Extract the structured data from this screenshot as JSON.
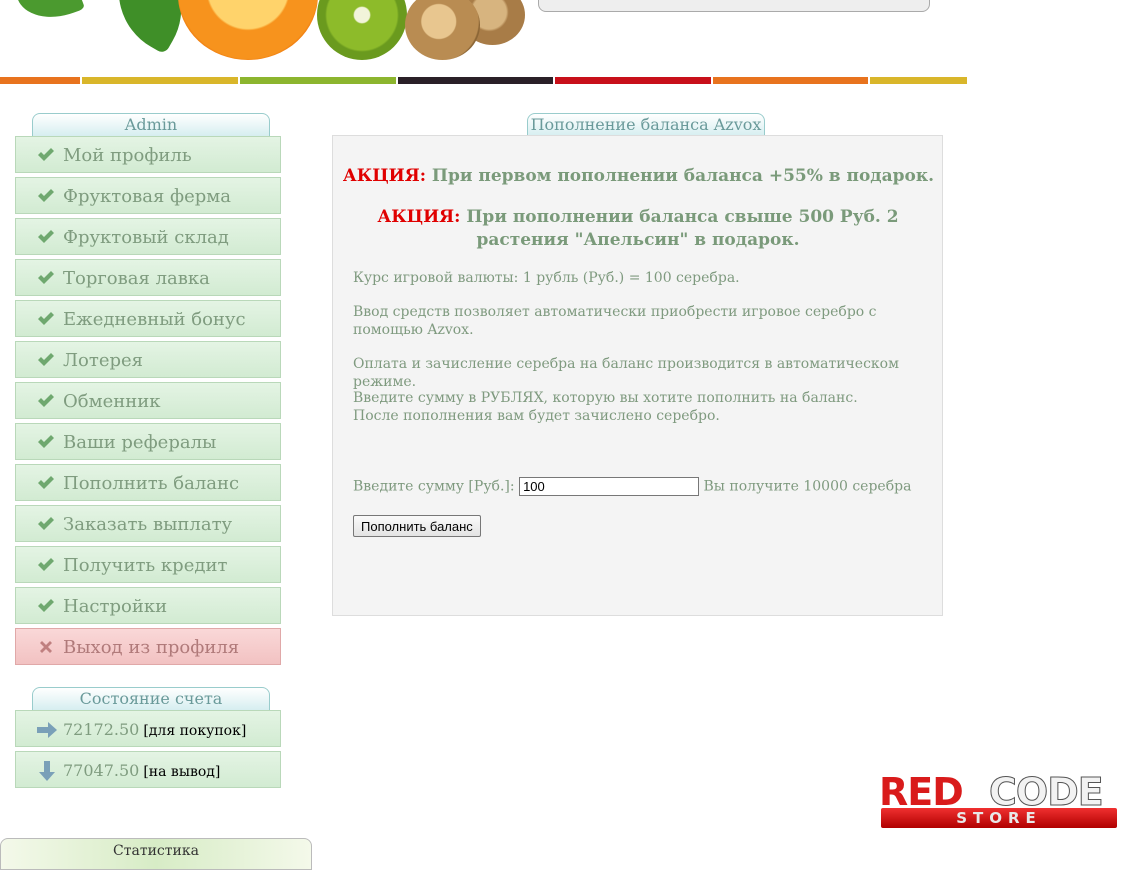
{
  "sidebar": {
    "section_title": "Admin",
    "items": [
      {
        "label": "Мой профиль"
      },
      {
        "label": "Фруктовая ферма"
      },
      {
        "label": "Фруктовый склад"
      },
      {
        "label": "Торговая лавка"
      },
      {
        "label": "Ежедневный бонус"
      },
      {
        "label": "Лотерея"
      },
      {
        "label": "Обменник"
      },
      {
        "label": "Ваши рефералы"
      },
      {
        "label": "Пополнить баланс"
      },
      {
        "label": "Заказать выплату"
      },
      {
        "label": "Получить кредит"
      },
      {
        "label": "Настройки"
      }
    ],
    "exit_label": "Выход из профиля"
  },
  "account": {
    "title": "Состояние счета",
    "purchase_balance": "72172.50",
    "purchase_note": "[для покупок]",
    "withdraw_balance": "77047.50",
    "withdraw_note": "[на вывод]"
  },
  "stats": {
    "title": "Статистика"
  },
  "main": {
    "tab_title": "Пополнение баланса Azvox",
    "promo1_label": "АКЦИЯ:",
    "promo1_text": "При первом пополнении баланса +55% в подарок.",
    "promo2_label": "АКЦИЯ:",
    "promo2_text": "При пополнении баланса свыше 500 Руб. 2 растения \"Апельсин\" в подарок.",
    "rate_text": "Курс игровой валюты: 1 рубль (Руб.) = 100 серебра.",
    "info1": "Ввод средств позволяет автоматически приобрести игровое серебро с помощью Azvox.",
    "info2": "Оплата и зачисление серебра на баланс производится в автоматическом режиме.",
    "info3_line1": "Введите сумму в РУБЛЯХ, которую вы хотите пополнить на баланс.",
    "info3_line2": "После пополнения вам будет зачислено серебро.",
    "amount_label": "Введите сумму [Руб.]:",
    "amount_value": "100",
    "receive_text": "Вы получите 10000 серебра",
    "submit_label": "Пополнить баланс"
  },
  "watermark": {
    "word1": "RED",
    "word2": "CODE",
    "word3": "STORE"
  },
  "colors": {
    "promo_highlight": "#e00000",
    "text_green": "#7f9a7f",
    "menu_bg": "#d9efd9",
    "exit_bg": "#f6cccc",
    "stripes": [
      "#e8731e",
      "#d9b62a",
      "#8cb52e",
      "#2a2028",
      "#c8101a",
      "#e8731e",
      "#d9b62a"
    ]
  }
}
